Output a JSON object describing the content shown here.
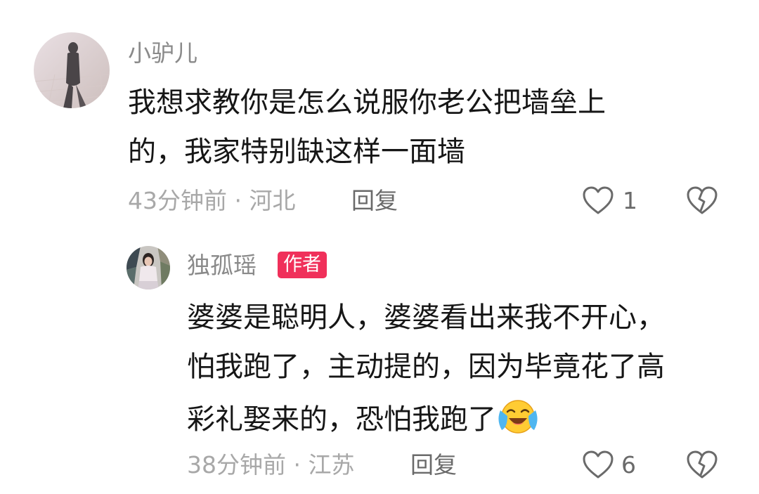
{
  "comments": [
    {
      "username": "小驴儿",
      "body_lines": [
        "我想求教你是怎么说服你老公把墙垒上",
        "的，我家特别缺这样一面墙"
      ],
      "meta": "43分钟前 · 河北",
      "reply_label": "回复",
      "like_count": "1",
      "avatar_icon": "user-avatar-shadow-photo"
    },
    {
      "username": "独孤瑶",
      "badge": "作者",
      "body_lines": [
        "婆婆是聪明人，婆婆看出来我不开心，",
        "怕我跑了，主动提的，因为毕竟花了高",
        "彩礼娶来的，恐怕我跑了"
      ],
      "emoji": "crying-laughing-emoji",
      "meta": "38分钟前 · 江苏",
      "reply_label": "回复",
      "like_count": "6",
      "avatar_icon": "author-avatar-photo"
    }
  ],
  "colors": {
    "badge_bg": "#f0305a",
    "meta_text": "#a8a8a8",
    "username_text": "#8a8a8a"
  }
}
